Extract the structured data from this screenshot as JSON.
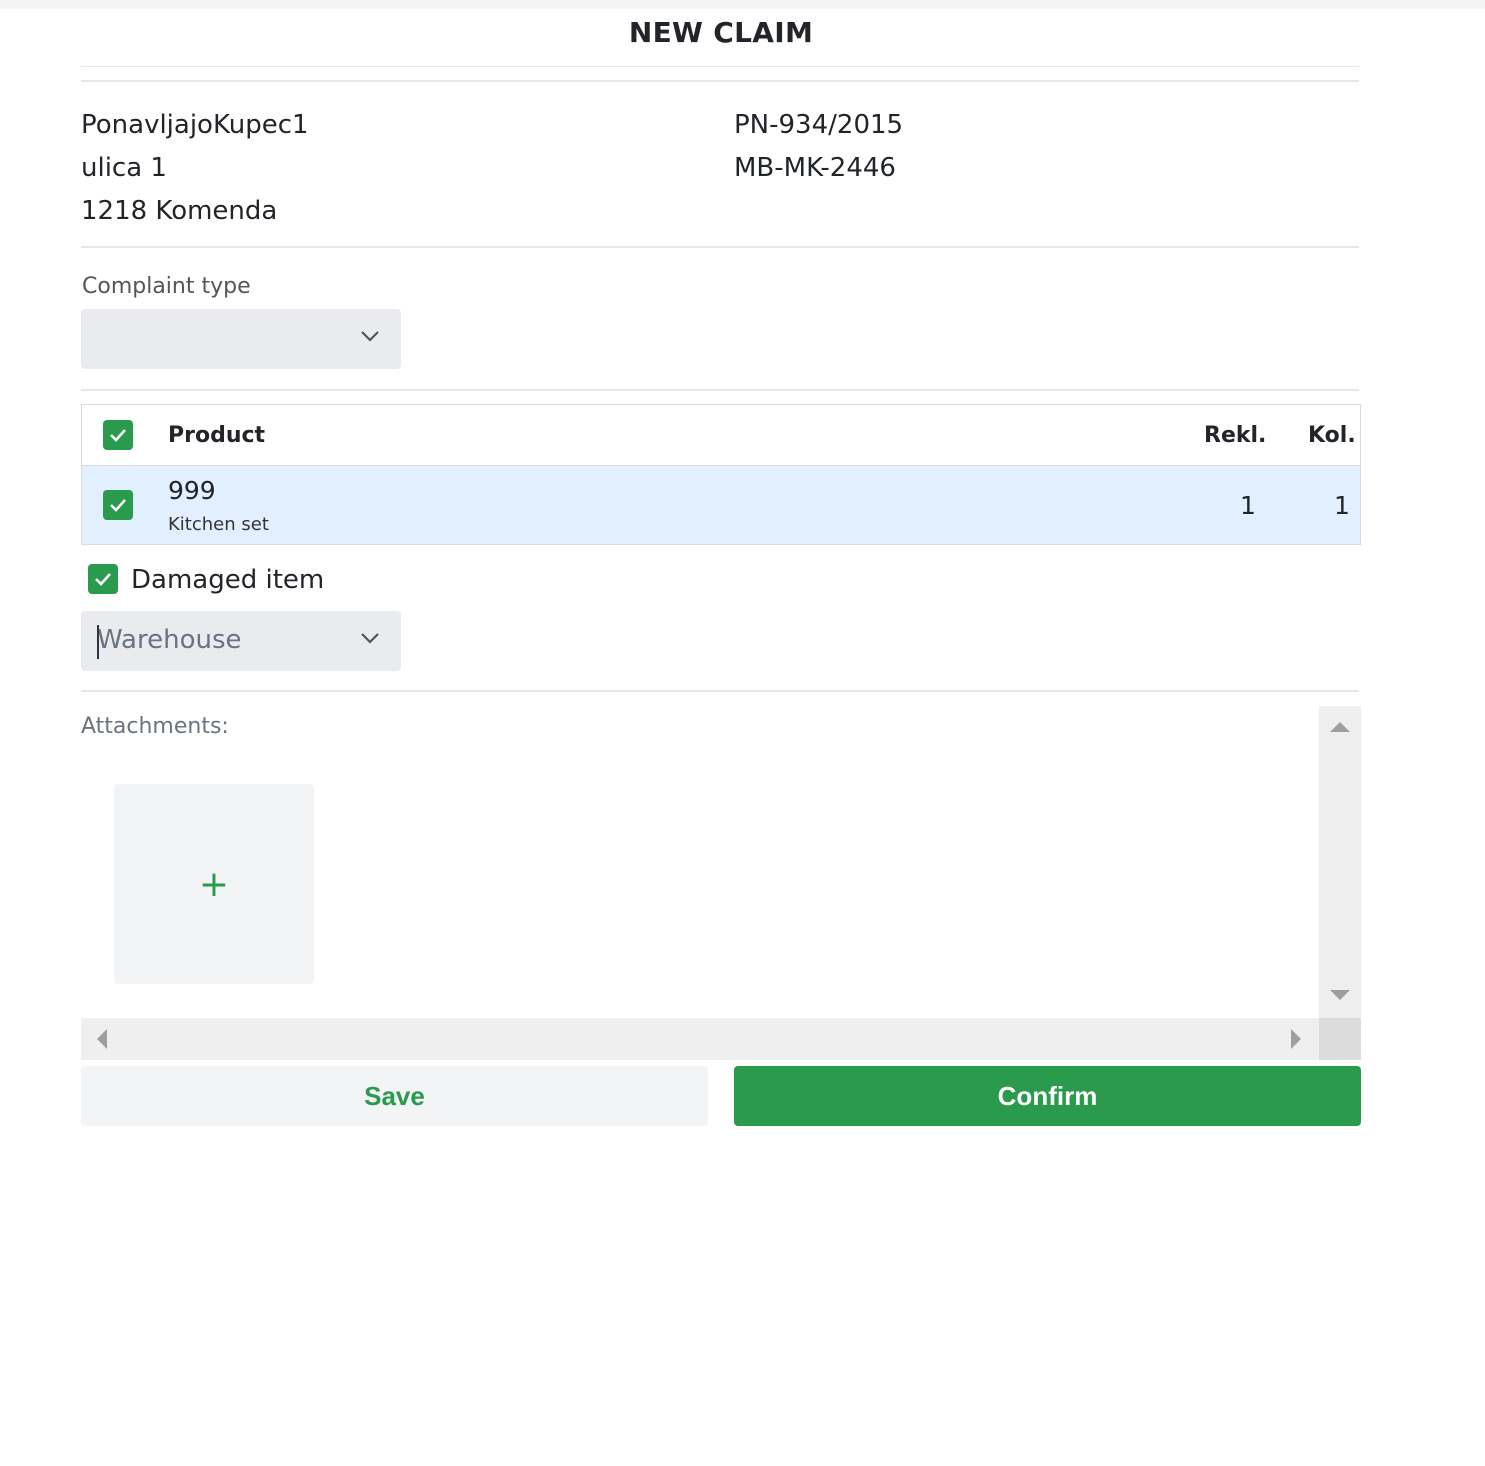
{
  "header": {
    "title": "NEW CLAIM"
  },
  "customer": {
    "name": "PonavljajoKupec1",
    "street": "ulica 1",
    "city": "1218 Komenda"
  },
  "document": {
    "invoice_no": "PN-934/2015",
    "ref_no": "MB-MK-2446"
  },
  "complaint_type": {
    "label": "Complaint type",
    "value": ""
  },
  "table": {
    "columns": {
      "product": "Product",
      "rekl": "Rekl.",
      "kol": "Kol."
    },
    "rows": [
      {
        "code": "999",
        "name": "Kitchen set",
        "rekl": "1",
        "kol": "1",
        "checked": true
      }
    ]
  },
  "damaged": {
    "label": "Damaged item",
    "checked": true
  },
  "warehouse": {
    "value": "Warehouse"
  },
  "attachments": {
    "label": "Attachments:",
    "add_symbol": "+"
  },
  "actions": {
    "save": "Save",
    "confirm": "Confirm"
  },
  "colors": {
    "accent": "#2a9a4d",
    "row_highlight": "#e2effe",
    "input_bg": "#e9ebef"
  }
}
